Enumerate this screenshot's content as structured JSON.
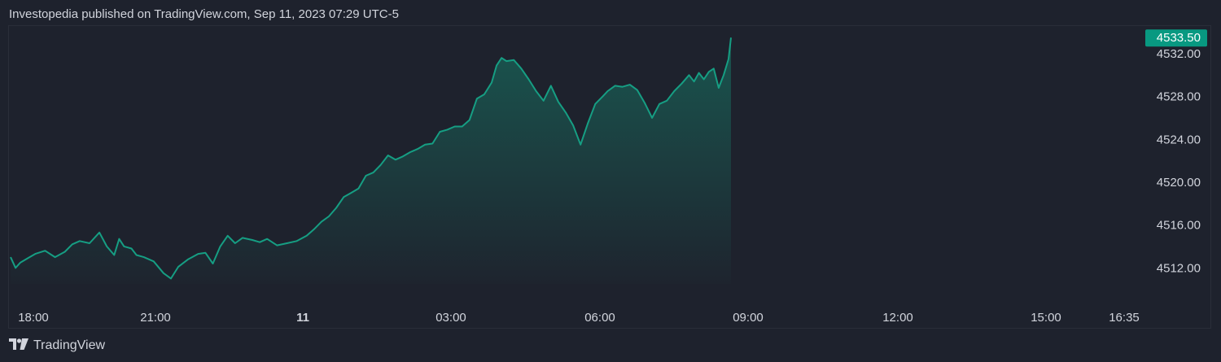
{
  "header": {
    "publisher_line": "Investopedia published on TradingView.com, Sep 11, 2023 07:29 UTC-5"
  },
  "footer": {
    "brand": "TradingView",
    "logo_icon": "tradingview-logo-icon"
  },
  "colors": {
    "background": "#1e222d",
    "line": "#169e83",
    "area_top": "#16806b",
    "price_badge": "#089981",
    "text": "#d1d4dc",
    "border": "#2a2e39"
  },
  "chart_data": {
    "type": "area",
    "title": "",
    "xlabel": "",
    "ylabel": "",
    "grid": false,
    "legend": "none",
    "last_price_label": "4533.50",
    "ylim": [
      4510.5,
      4534.5
    ],
    "y_ticks": [
      "4532.00",
      "4528.00",
      "4524.00",
      "4520.00",
      "4516.00",
      "4512.00"
    ],
    "x_ticks": [
      "18:00",
      "21:00",
      "11",
      "03:00",
      "06:00",
      "09:00",
      "12:00",
      "15:00",
      "16:35"
    ],
    "x_bold_tick": "11",
    "x_domain_hours": [
      18,
      40.6
    ],
    "x_unit": "hours since Sep 10 00:00 UTC-5",
    "series": [
      {
        "x": [
          18.0,
          18.1,
          18.2,
          18.35,
          18.5,
          18.7,
          18.9,
          19.1,
          19.25,
          19.4,
          19.6,
          19.8,
          19.95,
          20.1,
          20.2,
          20.3,
          20.45,
          20.55,
          20.7,
          20.9,
          21.1,
          21.25,
          21.4,
          21.6,
          21.8,
          21.95,
          22.1,
          22.25,
          22.4,
          22.55,
          22.7,
          22.9,
          23.05,
          23.2,
          23.4,
          23.6,
          23.8,
          24.0,
          24.15,
          24.3,
          24.45,
          24.6,
          24.75,
          24.9,
          25.05,
          25.2,
          25.35,
          25.5,
          25.65,
          25.8,
          25.95,
          26.1,
          26.25,
          26.4,
          26.55,
          26.7,
          26.85,
          27.0,
          27.15,
          27.3,
          27.45,
          27.6,
          27.75,
          27.85,
          27.95,
          28.05,
          28.2,
          28.35,
          28.5,
          28.65,
          28.8,
          28.95,
          29.1,
          29.25,
          29.4,
          29.55,
          29.7,
          29.85,
          30.0,
          30.1,
          30.25,
          30.4,
          30.55,
          30.7,
          30.85,
          31.0,
          31.15,
          31.3,
          31.45,
          31.6,
          31.75,
          31.85,
          31.95,
          32.05,
          32.15,
          32.25,
          32.35,
          32.45,
          32.55,
          32.6
        ],
        "values": [
          4513.0,
          4512.0,
          4512.5,
          4512.9,
          4513.3,
          4513.6,
          4513.0,
          4513.5,
          4514.2,
          4514.5,
          4514.3,
          4515.3,
          4514.0,
          4513.2,
          4514.7,
          4514.0,
          4513.8,
          4513.2,
          4513.0,
          4512.6,
          4511.5,
          4511.0,
          4512.1,
          4512.8,
          4513.3,
          4513.4,
          4512.4,
          4514.0,
          4515.0,
          4514.3,
          4514.8,
          4514.6,
          4514.4,
          4514.7,
          4514.1,
          4514.3,
          4514.5,
          4515.0,
          4515.6,
          4516.3,
          4516.8,
          4517.6,
          4518.6,
          4519.0,
          4519.4,
          4520.6,
          4520.9,
          4521.6,
          4522.5,
          4522.1,
          4522.4,
          4522.8,
          4523.1,
          4523.5,
          4523.6,
          4524.7,
          4524.9,
          4525.2,
          4525.2,
          4525.8,
          4527.8,
          4528.2,
          4529.3,
          4530.9,
          4531.6,
          4531.3,
          4531.4,
          4530.6,
          4529.6,
          4528.5,
          4527.6,
          4529.0,
          4527.5,
          4526.5,
          4525.3,
          4523.5,
          4525.5,
          4527.3,
          4528.0,
          4528.5,
          4529.0,
          4528.9,
          4529.1,
          4528.6,
          4527.4,
          4526.0,
          4527.3,
          4527.6,
          4528.5,
          4529.2,
          4530.0,
          4529.4,
          4530.2,
          4529.6,
          4530.3,
          4530.6,
          4528.8,
          4530.0,
          4531.5,
          4533.5
        ]
      }
    ]
  }
}
